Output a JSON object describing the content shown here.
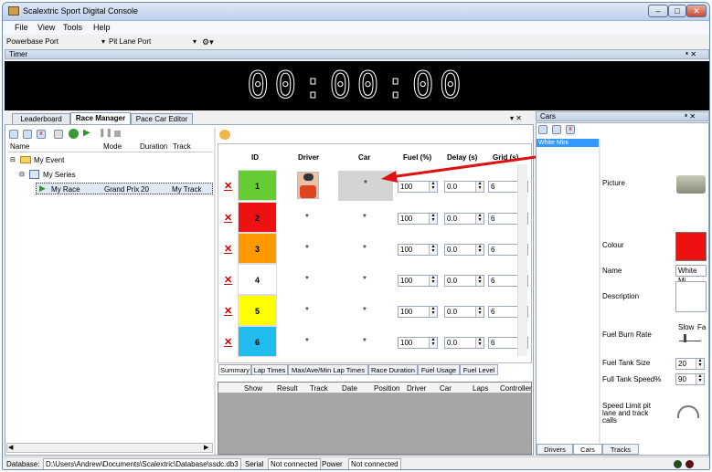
{
  "window": {
    "title": "Scalextric Sport Digital Console",
    "buttons": [
      "–",
      "□",
      "✕"
    ]
  },
  "menu": [
    "File",
    "View",
    "Tools",
    "Help"
  ],
  "toolbar": {
    "powerbase": "Powerbase Port",
    "pitlane": "Pit Lane Port",
    "caret": "▾"
  },
  "timer": {
    "title": "Timer",
    "pin": "ᵜ ✕",
    "display": "00:00:00"
  },
  "tabs": [
    "Leaderboard",
    "Race Manager",
    "Pace Car Editor"
  ],
  "tabctl": "▾ ✕",
  "tree": {
    "columns": [
      "Name",
      "Mode",
      "Duration",
      "Track"
    ],
    "event": "My Event",
    "series": "My Series",
    "race": {
      "name": "My Race",
      "mode": "Grand Prix",
      "duration": "20",
      "track": "My Track"
    }
  },
  "grid": {
    "columns": [
      "ID",
      "Driver",
      "Car",
      "Fuel (%)",
      "Delay (s)",
      "Grid (s)"
    ],
    "rows": [
      {
        "id": "1",
        "color": "#66cc33",
        "fuel": "100",
        "delay": "0.0",
        "grid": "6"
      },
      {
        "id": "2",
        "color": "#ee1111",
        "fuel": "100",
        "delay": "0.0",
        "grid": "6"
      },
      {
        "id": "3",
        "color": "#ff9900",
        "fuel": "100",
        "delay": "0.0",
        "grid": "6"
      },
      {
        "id": "4",
        "color": "#ffffff",
        "fuel": "100",
        "delay": "0.0",
        "grid": "6"
      },
      {
        "id": "5",
        "color": "#ffff00",
        "fuel": "100",
        "delay": "0.0",
        "grid": "6"
      },
      {
        "id": "6",
        "color": "#22bbee",
        "fuel": "100",
        "delay": "0.0",
        "grid": "6"
      }
    ],
    "placeholder": "*",
    "delete": "✕"
  },
  "summaryTabs": [
    "Summary",
    "Lap Times",
    "Max/Ave/Min Lap Times",
    "Race Duration",
    "Fuel Usage",
    "Fuel Level"
  ],
  "lapColumns": [
    "Show",
    "Result",
    "Track",
    "Date",
    "Position",
    "Driver",
    "Car",
    "Laps",
    "Controller"
  ],
  "cars": {
    "title": "Cars",
    "selected": "White Mini",
    "labels": {
      "picture": "Picture",
      "colour": "Colour",
      "name": "Name",
      "description": "Description",
      "burn": "Fuel Burn Rate",
      "tank": "Fuel Tank Size",
      "fullspeed": "Full Tank Speed%",
      "speedlimit": "Speed Limit pit lane and track calls"
    },
    "name": "White Mi",
    "colour": "#ee1111",
    "burnLabels": [
      "Slow",
      "Fa"
    ],
    "tank": "20",
    "fullspeed": "90",
    "bottomTabs": [
      "Drivers",
      "Cars",
      "Tracks"
    ]
  },
  "status": {
    "dbLabel": "Database:",
    "dbPath": "D:\\Users\\Andrew\\Documents\\Scalextric\\Database\\ssdc.db3",
    "serial": "Serial",
    "serialState": "Not connected",
    "power": "Power",
    "powerState": "Not connected"
  }
}
